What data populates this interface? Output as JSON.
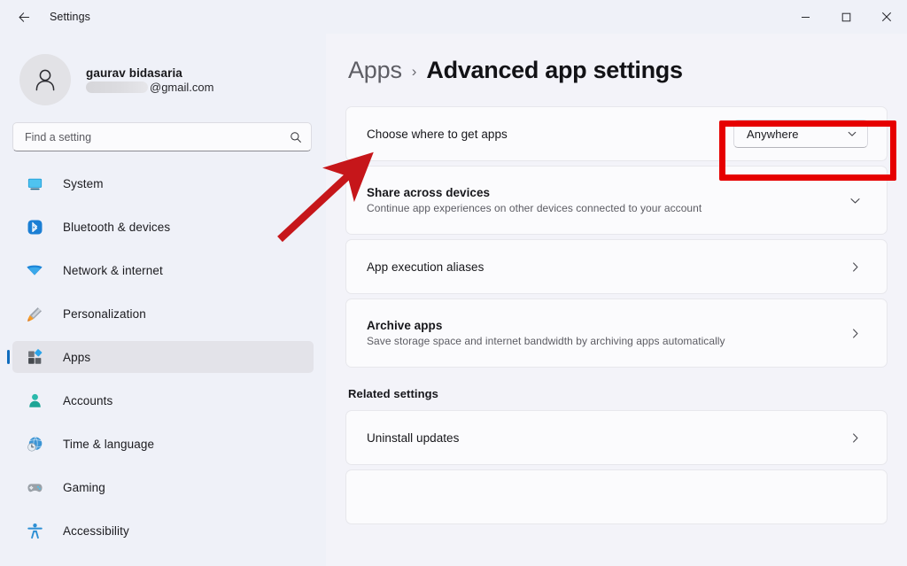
{
  "window": {
    "title": "Settings",
    "back_icon": "back-arrow-icon",
    "minimize_label": "Minimize",
    "maximize_label": "Maximize",
    "close_label": "Close"
  },
  "account": {
    "name": "gaurav bidasaria",
    "email_domain": "@gmail.com",
    "email_redacted": true,
    "avatar_icon": "person-icon"
  },
  "search": {
    "placeholder": "Find a setting",
    "value": "",
    "icon": "search-icon"
  },
  "sidebar": {
    "items": [
      {
        "label": "System",
        "icon": "monitor-icon",
        "selected": false
      },
      {
        "label": "Bluetooth & devices",
        "icon": "bluetooth-icon",
        "selected": false
      },
      {
        "label": "Network & internet",
        "icon": "wifi-icon",
        "selected": false
      },
      {
        "label": "Personalization",
        "icon": "paintbrush-icon",
        "selected": false
      },
      {
        "label": "Apps",
        "icon": "apps-grid-icon",
        "selected": true
      },
      {
        "label": "Accounts",
        "icon": "person-badge-icon",
        "selected": false
      },
      {
        "label": "Time & language",
        "icon": "clock-globe-icon",
        "selected": false
      },
      {
        "label": "Gaming",
        "icon": "gamepad-icon",
        "selected": false
      },
      {
        "label": "Accessibility",
        "icon": "accessibility-icon",
        "selected": false
      }
    ]
  },
  "breadcrumb": {
    "parent": "Apps",
    "separator": "›",
    "current": "Advanced app settings"
  },
  "main": {
    "cards": [
      {
        "title": "Choose where to get apps",
        "sub": "",
        "control": "combobox",
        "value": "Anywhere",
        "chevron": "chevron-down-icon",
        "highlighted": true
      },
      {
        "title": "Share across devices",
        "sub": "Continue app experiences on other devices connected to your account",
        "control": "expander",
        "value": "",
        "chevron": "chevron-down-icon",
        "highlighted": false
      },
      {
        "title": "App execution aliases",
        "sub": "",
        "control": "navigate",
        "value": "",
        "chevron": "chevron-right-icon",
        "highlighted": false
      },
      {
        "title": "Archive apps",
        "sub": "Save storage space and internet bandwidth by archiving apps automatically",
        "control": "navigate",
        "value": "",
        "chevron": "chevron-right-icon",
        "highlighted": false
      }
    ],
    "related_settings_heading": "Related settings",
    "related_cards": [
      {
        "title": "Uninstall updates",
        "sub": "",
        "control": "navigate",
        "chevron": "chevron-right-icon"
      }
    ]
  },
  "annotations": {
    "highlight_color": "#e60000",
    "arrow_color": "#c6161a",
    "highlight_target": "Anywhere dropdown",
    "arrow_target": "Choose where to get apps row"
  },
  "colors": {
    "sidebar_bg": "#eff1f8",
    "main_bg": "#f3f3f9",
    "card_bg": "#fbfbfd",
    "accent": "#0f6cbd",
    "text_primary": "#1b1b1f",
    "text_secondary": "#5c5c63"
  }
}
